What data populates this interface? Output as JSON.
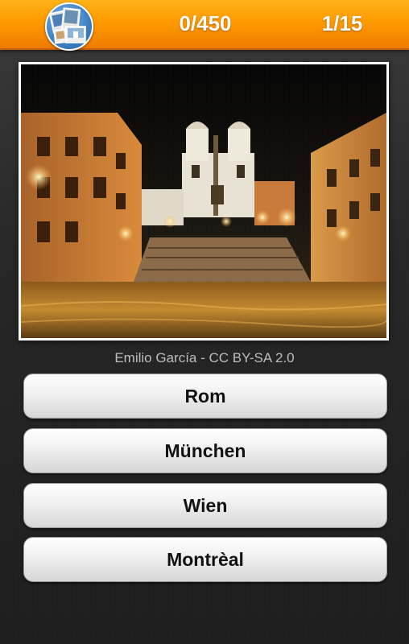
{
  "header": {
    "logo_icon": "photo-collage-globe-icon",
    "score": "0/450",
    "progress": "1/15",
    "accent_color": "#ff9a00"
  },
  "question": {
    "photo_icon": "night-city-square-photo",
    "credit": "Emilio García - CC BY-SA 2.0"
  },
  "answers": [
    {
      "label": "Rom"
    },
    {
      "label": "München"
    },
    {
      "label": "Wien"
    },
    {
      "label": "Montrèal"
    }
  ]
}
